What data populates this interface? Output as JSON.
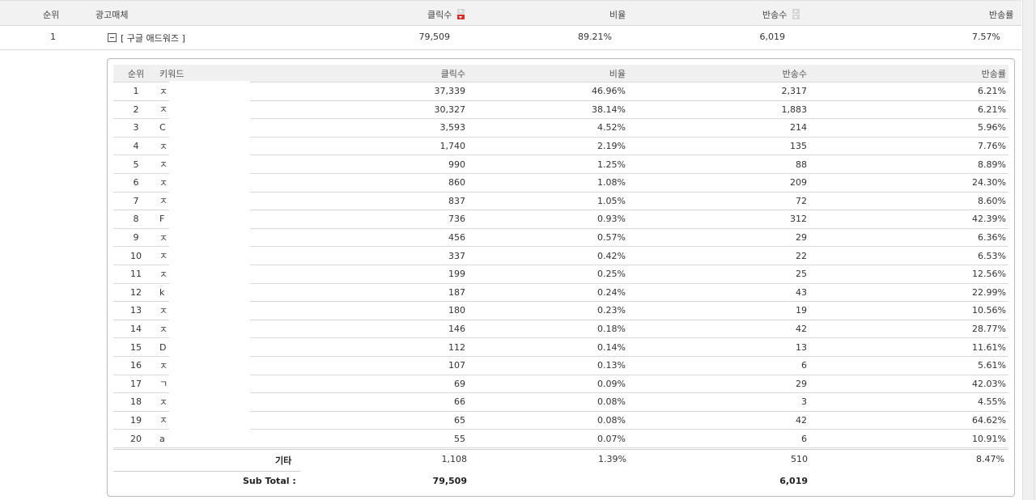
{
  "outer_header": {
    "rank": "순위",
    "media": "광고매체",
    "clicks": "클릭수",
    "ratio": "비율",
    "conversions": "반송수",
    "bounce_rate": "반송률"
  },
  "outer_row": {
    "rank": "1",
    "media_name": "[ 구글 애드워즈 ]",
    "clicks": "79,509",
    "ratio": "89.21%",
    "conversions": "6,019",
    "bounce_rate": "7.57%"
  },
  "inner_header": {
    "rank": "순위",
    "keyword": "키워드",
    "clicks": "클릭수",
    "ratio": "비율",
    "conversions": "반송수",
    "bounce_rate": "반송률"
  },
  "rows": [
    {
      "rank": "1",
      "kw": "ㅈ",
      "clicks": "37,339",
      "ratio": "46.96%",
      "conv": "2,317",
      "rate": "6.21%"
    },
    {
      "rank": "2",
      "kw": "ㅈ",
      "clicks": "30,327",
      "ratio": "38.14%",
      "conv": "1,883",
      "rate": "6.21%"
    },
    {
      "rank": "3",
      "kw": "C",
      "clicks": "3,593",
      "ratio": "4.52%",
      "conv": "214",
      "rate": "5.96%"
    },
    {
      "rank": "4",
      "kw": "ㅈ",
      "clicks": "1,740",
      "ratio": "2.19%",
      "conv": "135",
      "rate": "7.76%"
    },
    {
      "rank": "5",
      "kw": "ㅈ",
      "clicks": "990",
      "ratio": "1.25%",
      "conv": "88",
      "rate": "8.89%"
    },
    {
      "rank": "6",
      "kw": "ㅈ",
      "clicks": "860",
      "ratio": "1.08%",
      "conv": "209",
      "rate": "24.30%"
    },
    {
      "rank": "7",
      "kw": "ㅈ",
      "clicks": "837",
      "ratio": "1.05%",
      "conv": "72",
      "rate": "8.60%"
    },
    {
      "rank": "8",
      "kw": "F",
      "clicks": "736",
      "ratio": "0.93%",
      "conv": "312",
      "rate": "42.39%"
    },
    {
      "rank": "9",
      "kw": "ㅈ",
      "clicks": "456",
      "ratio": "0.57%",
      "conv": "29",
      "rate": "6.36%"
    },
    {
      "rank": "10",
      "kw": "ㅈ",
      "clicks": "337",
      "ratio": "0.42%",
      "conv": "22",
      "rate": "6.53%"
    },
    {
      "rank": "11",
      "kw": "ㅈ",
      "clicks": "199",
      "ratio": "0.25%",
      "conv": "25",
      "rate": "12.56%"
    },
    {
      "rank": "12",
      "kw": "k",
      "clicks": "187",
      "ratio": "0.24%",
      "conv": "43",
      "rate": "22.99%"
    },
    {
      "rank": "13",
      "kw": "ㅈ",
      "clicks": "180",
      "ratio": "0.23%",
      "conv": "19",
      "rate": "10.56%"
    },
    {
      "rank": "14",
      "kw": "ㅈ",
      "clicks": "146",
      "ratio": "0.18%",
      "conv": "42",
      "rate": "28.77%"
    },
    {
      "rank": "15",
      "kw": "D",
      "clicks": "112",
      "ratio": "0.14%",
      "conv": "13",
      "rate": "11.61%"
    },
    {
      "rank": "16",
      "kw": "ㅈ",
      "clicks": "107",
      "ratio": "0.13%",
      "conv": "6",
      "rate": "5.61%"
    },
    {
      "rank": "17",
      "kw": "ㄱ",
      "clicks": "69",
      "ratio": "0.09%",
      "conv": "29",
      "rate": "42.03%"
    },
    {
      "rank": "18",
      "kw": "ㅈ",
      "clicks": "66",
      "ratio": "0.08%",
      "conv": "3",
      "rate": "4.55%"
    },
    {
      "rank": "19",
      "kw": "ㅈ",
      "clicks": "65",
      "ratio": "0.08%",
      "conv": "42",
      "rate": "64.62%"
    },
    {
      "rank": "20",
      "kw": "a",
      "clicks": "55",
      "ratio": "0.07%",
      "conv": "6",
      "rate": "10.91%"
    }
  ],
  "etc": {
    "label": "기타",
    "clicks": "1,108",
    "ratio": "1.39%",
    "conv": "510",
    "rate": "8.47%"
  },
  "subtotal": {
    "label": "Sub Total :",
    "clicks": "79,509",
    "conv": "6,019"
  },
  "colors": {
    "header_bg": "#f2f2f2",
    "sort_active": "#d9302c",
    "border": "#d9d9d9"
  }
}
